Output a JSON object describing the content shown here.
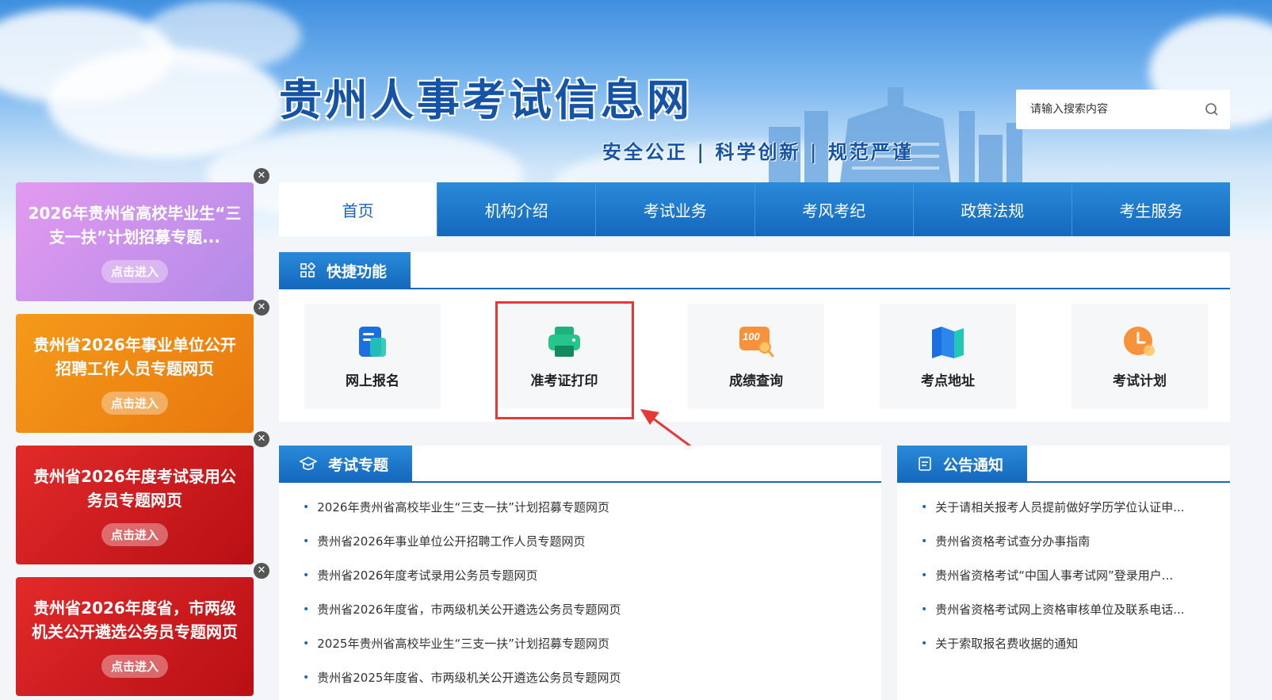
{
  "header": {
    "site_title": "贵州人事考试信息网",
    "slogan": "安全公正 | 科学创新 | 规范严谨",
    "search_placeholder": "请输入搜索内容"
  },
  "ads": [
    {
      "title": "2026年贵州省高校毕业生“三支一扶”计划招募专题...",
      "button": "点击进入",
      "color": "#c48bec"
    },
    {
      "title": "贵州省2026年事业单位公开招聘工作人员专题网页",
      "button": "点击进入",
      "color": "#ef8a12"
    },
    {
      "title": "贵州省2026年度考试录用公务员专题网页",
      "button": "点击进入",
      "color": "#d81e1e"
    },
    {
      "title": "贵州省2026年度省，市两级机关公开遴选公务员专题网页",
      "button": "点击进入",
      "color": "#d81e1e"
    }
  ],
  "nav": {
    "items": [
      "首页",
      "机构介绍",
      "考试业务",
      "考风考纪",
      "政策法规",
      "考生服务"
    ],
    "active_index": 0
  },
  "quick": {
    "heading": "快捷功能",
    "items": [
      {
        "label": "网上报名",
        "icon": "form-icon"
      },
      {
        "label": "准考证打印",
        "icon": "printer-icon"
      },
      {
        "label": "成绩查询",
        "icon": "score-icon"
      },
      {
        "label": "考点地址",
        "icon": "map-icon"
      },
      {
        "label": "考试计划",
        "icon": "clock-icon"
      }
    ]
  },
  "topics": {
    "heading": "考试专题",
    "items": [
      "2026年贵州省高校毕业生“三支一扶”计划招募专题网页",
      "贵州省2026年事业单位公开招聘工作人员专题网页",
      "贵州省2026年度考试录用公务员专题网页",
      "贵州省2026年度省，市两级机关公开遴选公务员专题网页",
      "2025年贵州省高校毕业生“三支一扶”计划招募专题网页",
      "贵州省2025年度省、市两级机关公开遴选公务员专题网页"
    ]
  },
  "notices": {
    "heading": "公告通知",
    "items": [
      "关于请相关报考人员提前做好学历学位认证申...",
      "贵州省资格考试查分办事指南",
      "贵州省资格考试“中国人事考试网”登录用户...",
      "贵州省资格考试网上资格审核单位及联系电话...",
      "关于索取报名费收据的通知"
    ]
  },
  "colors": {
    "primary": "#1468bd",
    "highlight": "#e53935"
  }
}
